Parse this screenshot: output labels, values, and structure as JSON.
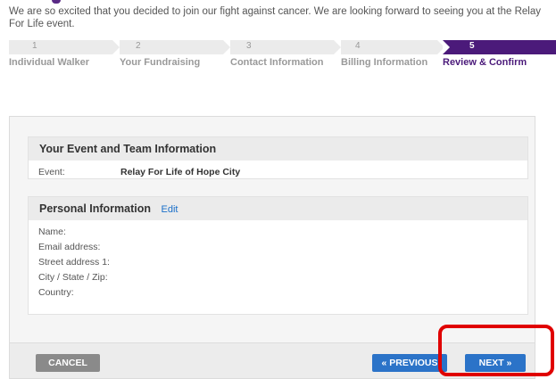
{
  "intro_text": "We are so excited that you decided to join our fight against cancer. We are looking forward to seeing you at the Relay For Life event.",
  "steps": [
    {
      "num": "1",
      "label": "Individual Walker"
    },
    {
      "num": "2",
      "label": "Your Fundraising"
    },
    {
      "num": "3",
      "label": "Contact Information"
    },
    {
      "num": "4",
      "label": "Billing Information"
    },
    {
      "num": "5",
      "label": "Review & Confirm"
    }
  ],
  "event_section": {
    "title": "Your Event and Team Information",
    "rows": [
      {
        "label": "Event:",
        "value": "Relay For Life of Hope City"
      }
    ]
  },
  "personal_section": {
    "title": "Personal Information",
    "edit_label": "Edit",
    "rows": [
      {
        "label": "Name:",
        "value": ""
      },
      {
        "label": "Email address:",
        "value": ""
      },
      {
        "label": "Street address 1:",
        "value": ""
      },
      {
        "label": "City / State / Zip:",
        "value": ""
      },
      {
        "label": "Country:",
        "value": ""
      }
    ]
  },
  "buttons": {
    "cancel": "CANCEL",
    "previous": "« PREVIOUS",
    "next": "NEXT »"
  },
  "colors": {
    "brand_purple": "#4b1a7a",
    "button_blue": "#2b73c8",
    "highlight_red": "#e00000"
  }
}
